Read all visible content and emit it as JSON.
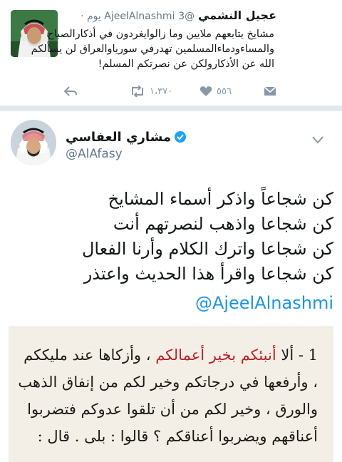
{
  "reply_tweet": {
    "name": "عجيل النشمي",
    "handle": "@AjeelAlnashmi",
    "time": "3 يوم ·",
    "body": [
      "مشايخ يتابعهم ملايين وما زالوايغردون في أذكارالصباح",
      "والمساءودماءالمسلمين تهدرفي سورياوالعراق لن يسألكم",
      "الله عن الأذكارولكن عن نصرتكم المسلم!"
    ],
    "retweet_count": "١،٣٧٠",
    "like_count": "٥٥٦",
    "icons": {
      "reply": "reply-icon",
      "retweet": "retweet-icon",
      "like": "heart-icon",
      "message": "envelope-icon",
      "menu": "chevron-down-icon"
    }
  },
  "main_tweet": {
    "name": "مشاري العفاسي",
    "handle": "@AlAfasy",
    "verified": true,
    "body": [
      "كن شجاعاً واذكر أسماء المشايخ",
      "كن شجاعا واذهب لنصرتهم أنت",
      "كن شجاعا واترك الكلام وأرنا الفعال",
      "كن شجاعا واقرأ هذا الحديث واعتذر"
    ],
    "mention": "@AjeelAlnashmi"
  },
  "attached_image": {
    "lines": [
      {
        "before": "1 - ألا ",
        "highlight": "أنبئكم بخير أعمالكم",
        "after": " ، وأزكاها عند مليككم"
      },
      {
        "before": "، وأرفعها في درجاتكم وخير لكم من إنفاق الذهب",
        "highlight": "",
        "after": ""
      },
      {
        "before": "والورق ، وخير لكم من أن تلقوا عدوكم فتضربوا",
        "highlight": "",
        "after": ""
      },
      {
        "before": "أعناقهم ويضربوا أعناقكم ؟ قالوا : بلى . قال :",
        "highlight": "",
        "after": ""
      }
    ]
  },
  "colors": {
    "link": "#1b95e0",
    "muted": "#657786",
    "separator": "#e1e8ed",
    "verified": "#1da1f2",
    "highlight_text": "#b8202a"
  }
}
